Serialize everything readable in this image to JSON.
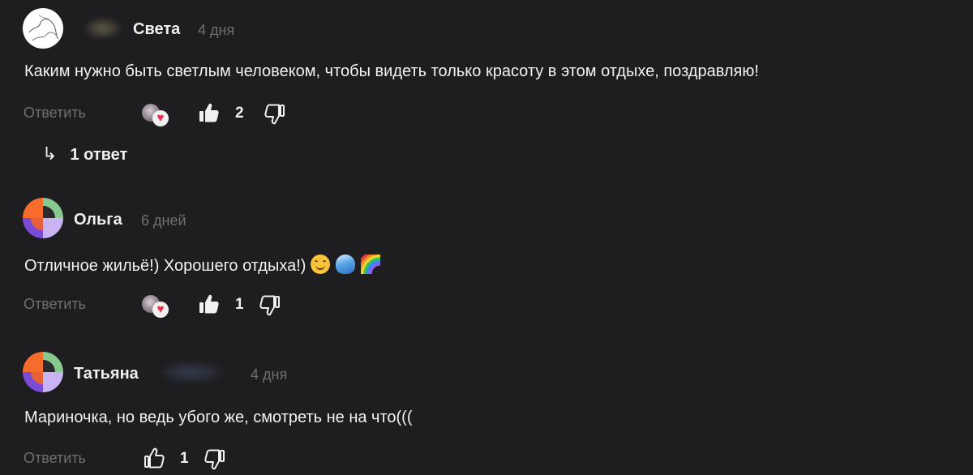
{
  "labels": {
    "reply": "Ответить"
  },
  "comments": [
    {
      "author": "Света",
      "date": "4 дня",
      "text": "Каким нужно быть светлым человеком, чтобы видеть только красоту в этом отдыхе, поздравляю!",
      "likes": "2",
      "has_reaction": true,
      "replies": "1 ответ"
    },
    {
      "author": "Ольга",
      "date": "6 дней",
      "text": "Отличное жильё!) Хорошего отдыха!)",
      "emojis": [
        "smile-emoji",
        "wave-emoji",
        "rainbow-emoji"
      ],
      "likes": "1",
      "has_reaction": true
    },
    {
      "author": "Татьяна",
      "date": "4 дня",
      "text": "Мариночка, но ведь убого же, смотреть не на что(((",
      "likes": "1",
      "has_reaction": false
    }
  ],
  "colors": {
    "background": "#1e1e21",
    "muted": "#6f6f73",
    "heart": "#e8304a",
    "avatar_orange": "#f56c2c",
    "avatar_green": "#87c98e",
    "avatar_purple": "#7a4bd6",
    "avatar_lilac": "#c9b3f2"
  },
  "icons": [
    "like-icon",
    "dislike-icon",
    "reply-arrow-icon",
    "heart-reaction-icon"
  ]
}
